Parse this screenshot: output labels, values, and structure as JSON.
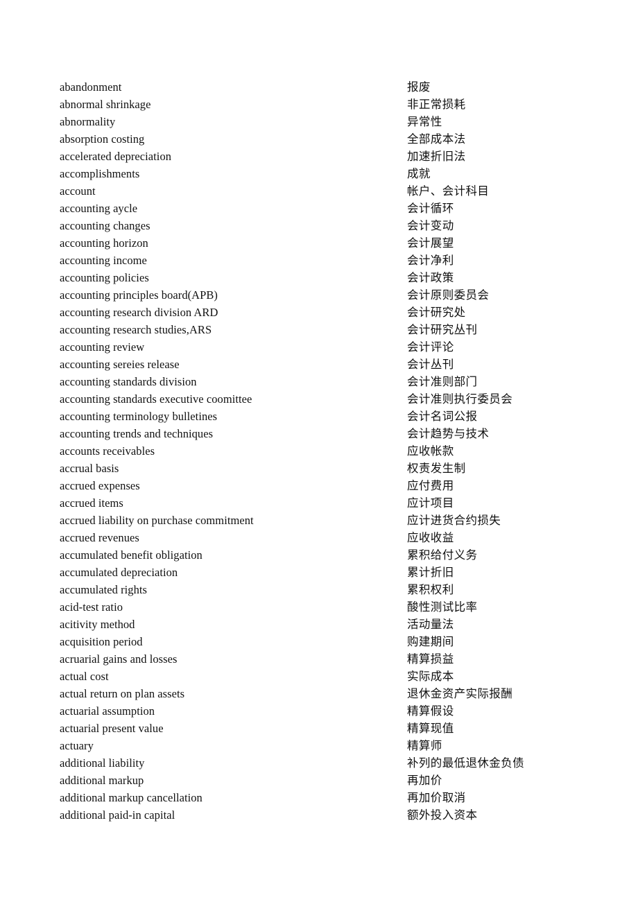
{
  "document": {
    "type": "bilingual-glossary",
    "language_pair": "English-Chinese",
    "background_color": "#ffffff",
    "text_color": "#111111"
  },
  "entries": [
    {
      "en": "abandonment",
      "zh": "报废"
    },
    {
      "en": "abnormal shrinkage",
      "zh": "非正常损耗"
    },
    {
      "en": "abnormality",
      "zh": "异常性"
    },
    {
      "en": "absorption costing",
      "zh": "全部成本法"
    },
    {
      "en": "accelerated depreciation",
      "zh": "加速折旧法"
    },
    {
      "en": "accomplishments",
      "zh": "成就"
    },
    {
      "en": "account",
      "zh": "帐户、会计科目"
    },
    {
      "en": "accounting aycle",
      "zh": "会计循环"
    },
    {
      "en": "accounting changes",
      "zh": "会计变动"
    },
    {
      "en": "accounting horizon",
      "zh": "会计展望"
    },
    {
      "en": "accounting income",
      "zh": "会计净利"
    },
    {
      "en": "accounting policies",
      "zh": "会计政策"
    },
    {
      "en": "accounting principles board(APB)",
      "zh": "会计原则委员会"
    },
    {
      "en": "accounting research division ARD",
      "zh": "会计研究处"
    },
    {
      "en": "accounting research studies,ARS",
      "zh": "会计研究丛刊"
    },
    {
      "en": "accounting review",
      "zh": "会计评论"
    },
    {
      "en": "accounting sereies release",
      "zh": "会计丛刊"
    },
    {
      "en": "accounting standards division",
      "zh": "会计准则部门"
    },
    {
      "en": "accounting standards executive coomittee",
      "zh": "会计准则执行委员会"
    },
    {
      "en": "accounting terminology bulletines",
      "zh": "会计名词公报"
    },
    {
      "en": "accounting trends and techniques",
      "zh": "会计趋势与技术"
    },
    {
      "en": "accounts receivables",
      "zh": "应收帐款"
    },
    {
      "en": "accrual basis",
      "zh": "权责发生制"
    },
    {
      "en": "accrued expenses",
      "zh": "应付费用"
    },
    {
      "en": "accrued items",
      "zh": "应计项目"
    },
    {
      "en": "accrued liability on purchase commitment",
      "zh": "应计进货合约损失"
    },
    {
      "en": "accrued revenues",
      "zh": "应收收益"
    },
    {
      "en": "accumulated benefit obligation",
      "zh": "累积给付义务"
    },
    {
      "en": "accumulated depreciation",
      "zh": "累计折旧"
    },
    {
      "en": "accumulated rights",
      "zh": "累积权利"
    },
    {
      "en": "acid-test ratio",
      "zh": "酸性测试比率"
    },
    {
      "en": "acitivity method",
      "zh": "活动量法"
    },
    {
      "en": "acquisition period",
      "zh": "购建期间"
    },
    {
      "en": "acruarial gains and losses",
      "zh": "精算损益"
    },
    {
      "en": "actual cost",
      "zh": "实际成本"
    },
    {
      "en": "actual return on plan assets",
      "zh": "退休金资产实际报酬"
    },
    {
      "en": "actuarial assumption",
      "zh": "精算假设"
    },
    {
      "en": "actuarial present value",
      "zh": "精算现值"
    },
    {
      "en": "actuary",
      "zh": "精算师"
    },
    {
      "en": "additional liability",
      "zh": "补列的最低退休金负债"
    },
    {
      "en": "additional markup",
      "zh": "再加价"
    },
    {
      "en": "additional markup cancellation",
      "zh": "再加价取消"
    },
    {
      "en": "additional paid-in capital",
      "zh": "额外投入资本"
    }
  ]
}
